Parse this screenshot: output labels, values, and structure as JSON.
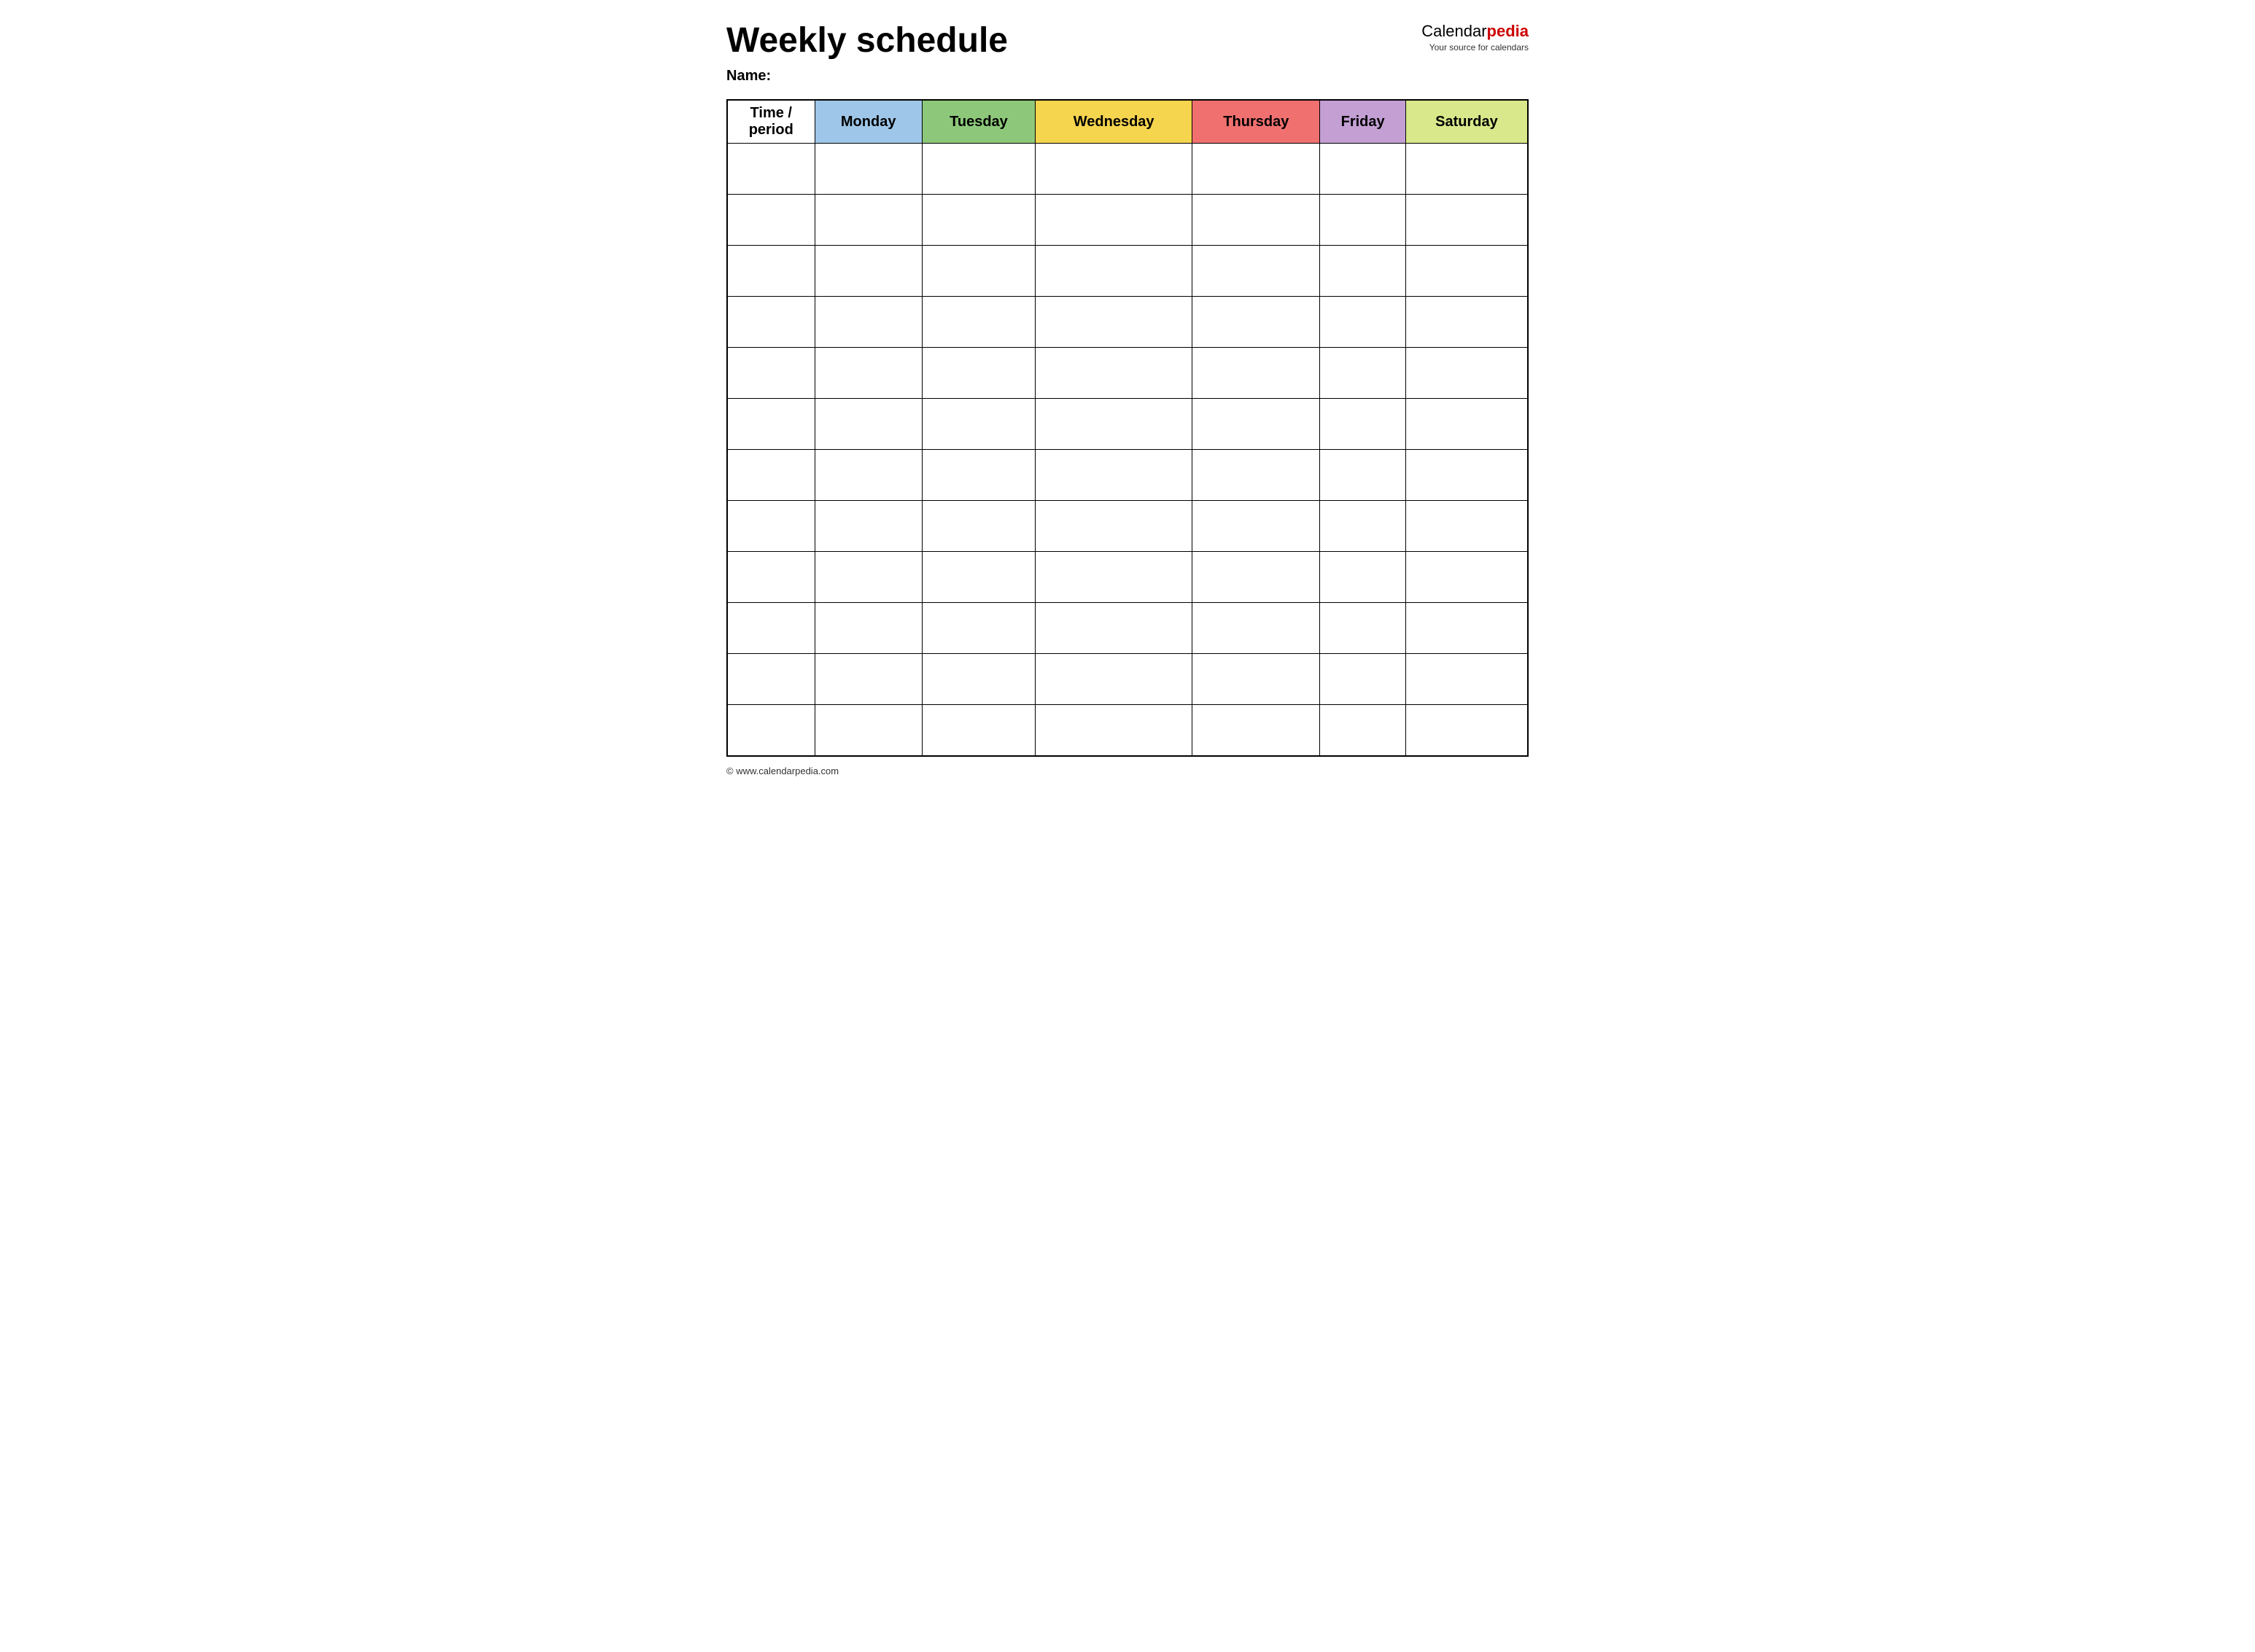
{
  "header": {
    "title": "Weekly schedule",
    "name_label": "Name:",
    "logo_calendar": "Calendar",
    "logo_pedia": "pedia",
    "logo_tagline": "Your source for calendars"
  },
  "table": {
    "columns": [
      {
        "id": "time",
        "label": "Time / period",
        "color": "#ffffff"
      },
      {
        "id": "monday",
        "label": "Monday",
        "color": "#9ec6e8"
      },
      {
        "id": "tuesday",
        "label": "Tuesday",
        "color": "#8dc87a"
      },
      {
        "id": "wednesday",
        "label": "Wednesday",
        "color": "#f5d44e"
      },
      {
        "id": "thursday",
        "label": "Thursday",
        "color": "#f07070"
      },
      {
        "id": "friday",
        "label": "Friday",
        "color": "#c39fd4"
      },
      {
        "id": "saturday",
        "label": "Saturday",
        "color": "#d8e88a"
      }
    ],
    "rows": 12
  },
  "footer": {
    "url": "© www.calendarpedia.com"
  }
}
